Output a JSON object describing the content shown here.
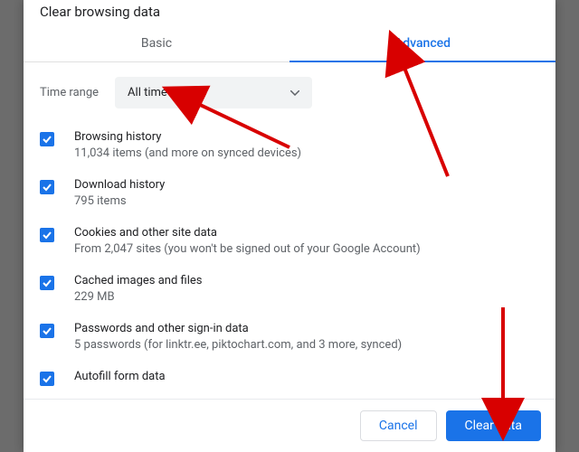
{
  "dialog": {
    "title": "Clear browsing data",
    "tabs": {
      "basic": "Basic",
      "advanced": "Advanced"
    },
    "timeRange": {
      "label": "Time range",
      "value": "All time"
    },
    "items": [
      {
        "title": "Browsing history",
        "sub": "11,034 items (and more on synced devices)"
      },
      {
        "title": "Download history",
        "sub": "795 items"
      },
      {
        "title": "Cookies and other site data",
        "sub": "From 2,047 sites (you won't be signed out of your Google Account)"
      },
      {
        "title": "Cached images and files",
        "sub": "229 MB"
      },
      {
        "title": "Passwords and other sign-in data",
        "sub": "5 passwords (for linktr.ee, piktochart.com, and 3 more, synced)"
      },
      {
        "title": "Autofill form data",
        "sub": ""
      }
    ],
    "buttons": {
      "cancel": "Cancel",
      "clear": "Clear data"
    }
  }
}
